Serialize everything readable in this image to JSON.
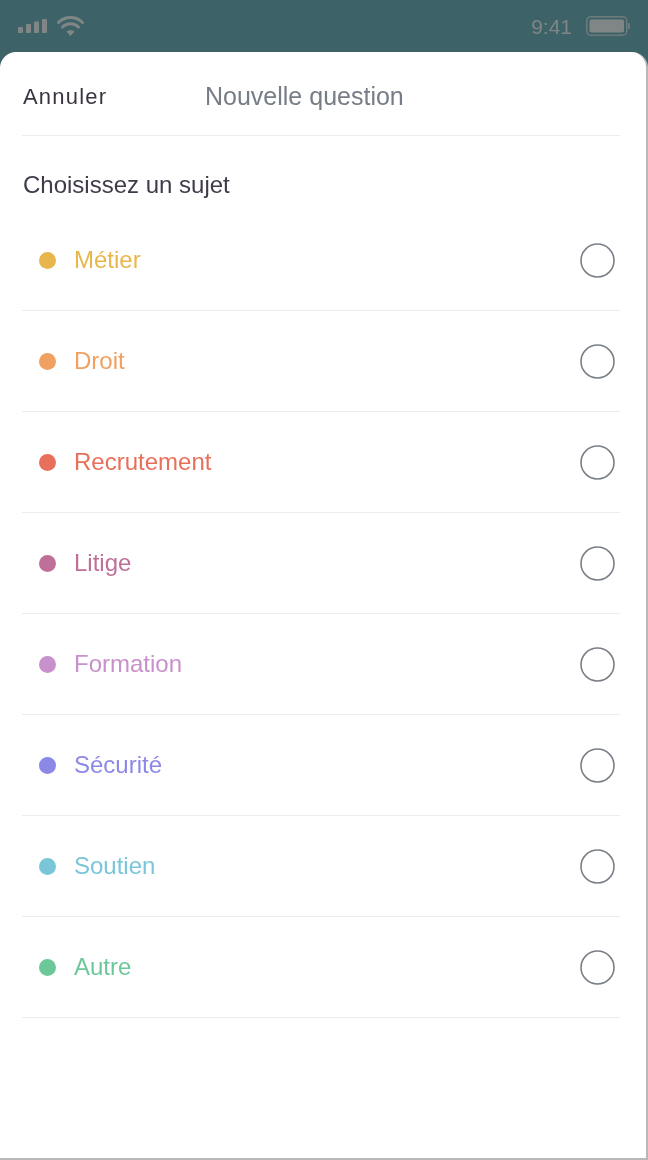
{
  "status_bar": {
    "time": "9:41"
  },
  "header": {
    "cancel": "Annuler",
    "title": "Nouvelle question"
  },
  "section_title": "Choisissez un sujet",
  "topics": [
    {
      "label": "Métier",
      "color": "#e8b64a",
      "selected": false
    },
    {
      "label": "Droit",
      "color": "#f0a060",
      "selected": false
    },
    {
      "label": "Recrutement",
      "color": "#e8705a",
      "selected": false
    },
    {
      "label": "Litige",
      "color": "#c07098",
      "selected": false
    },
    {
      "label": "Formation",
      "color": "#c890cc",
      "selected": false
    },
    {
      "label": "Sécurité",
      "color": "#8c88e6",
      "selected": false
    },
    {
      "label": "Soutien",
      "color": "#78c6d8",
      "selected": false
    },
    {
      "label": "Autre",
      "color": "#6cc898",
      "selected": false
    }
  ]
}
